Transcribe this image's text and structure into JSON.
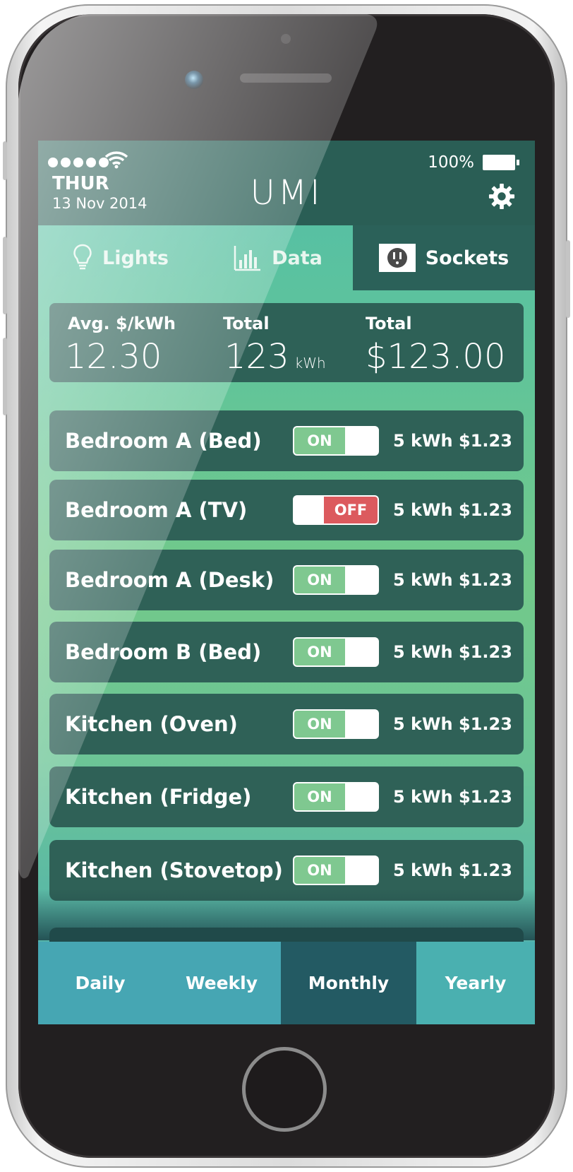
{
  "status": {
    "signal_dots": 5,
    "day": "THUR",
    "date": "13 Nov 2014",
    "battery": "100%",
    "settings_icon": "gear-icon"
  },
  "app": {
    "title": "UMI"
  },
  "tabs": [
    {
      "label": "Lights",
      "icon": "lightbulb-icon",
      "selected": false
    },
    {
      "label": "Data",
      "icon": "bar-chart-icon",
      "selected": false
    },
    {
      "label": "Sockets",
      "icon": "socket-icon",
      "selected": true
    }
  ],
  "summary": {
    "avg_label": "Avg. $/kWh",
    "avg_value": "12.30",
    "total_energy_label": "Total",
    "total_energy_value": "123",
    "total_energy_unit": "kWh",
    "total_cost_label": "Total",
    "total_cost_value": "$123.00"
  },
  "sockets": [
    {
      "name": "Bedroom A (Bed)",
      "state": "ON",
      "energy": "5 kWh",
      "cost": "$1.23"
    },
    {
      "name": "Bedroom A (TV)",
      "state": "OFF",
      "energy": "5 kWh",
      "cost": "$1.23"
    },
    {
      "name": "Bedroom A (Desk)",
      "state": "ON",
      "energy": "5 kWh",
      "cost": "$1.23"
    },
    {
      "name": "Bedroom B (Bed)",
      "state": "ON",
      "energy": "5 kWh",
      "cost": "$1.23"
    },
    {
      "name": "Kitchen (Oven)",
      "state": "ON",
      "energy": "5 kWh",
      "cost": "$1.23"
    },
    {
      "name": "Kitchen (Fridge)",
      "state": "ON",
      "energy": "5 kWh",
      "cost": "$1.23"
    },
    {
      "name": "Kitchen (Stovetop)",
      "state": "ON",
      "energy": "5 kWh",
      "cost": "$1.23"
    }
  ],
  "periods": [
    {
      "label": "Daily",
      "selected": false
    },
    {
      "label": "Weekly",
      "selected": false
    },
    {
      "label": "Monthly",
      "selected": true
    },
    {
      "label": "Yearly",
      "selected": false
    }
  ],
  "colors": {
    "header": "#2a5e55",
    "row": "#2f6157",
    "toggle_on": "#7fc890",
    "toggle_off": "#dc5a5e",
    "period_selected": "#235a63"
  }
}
